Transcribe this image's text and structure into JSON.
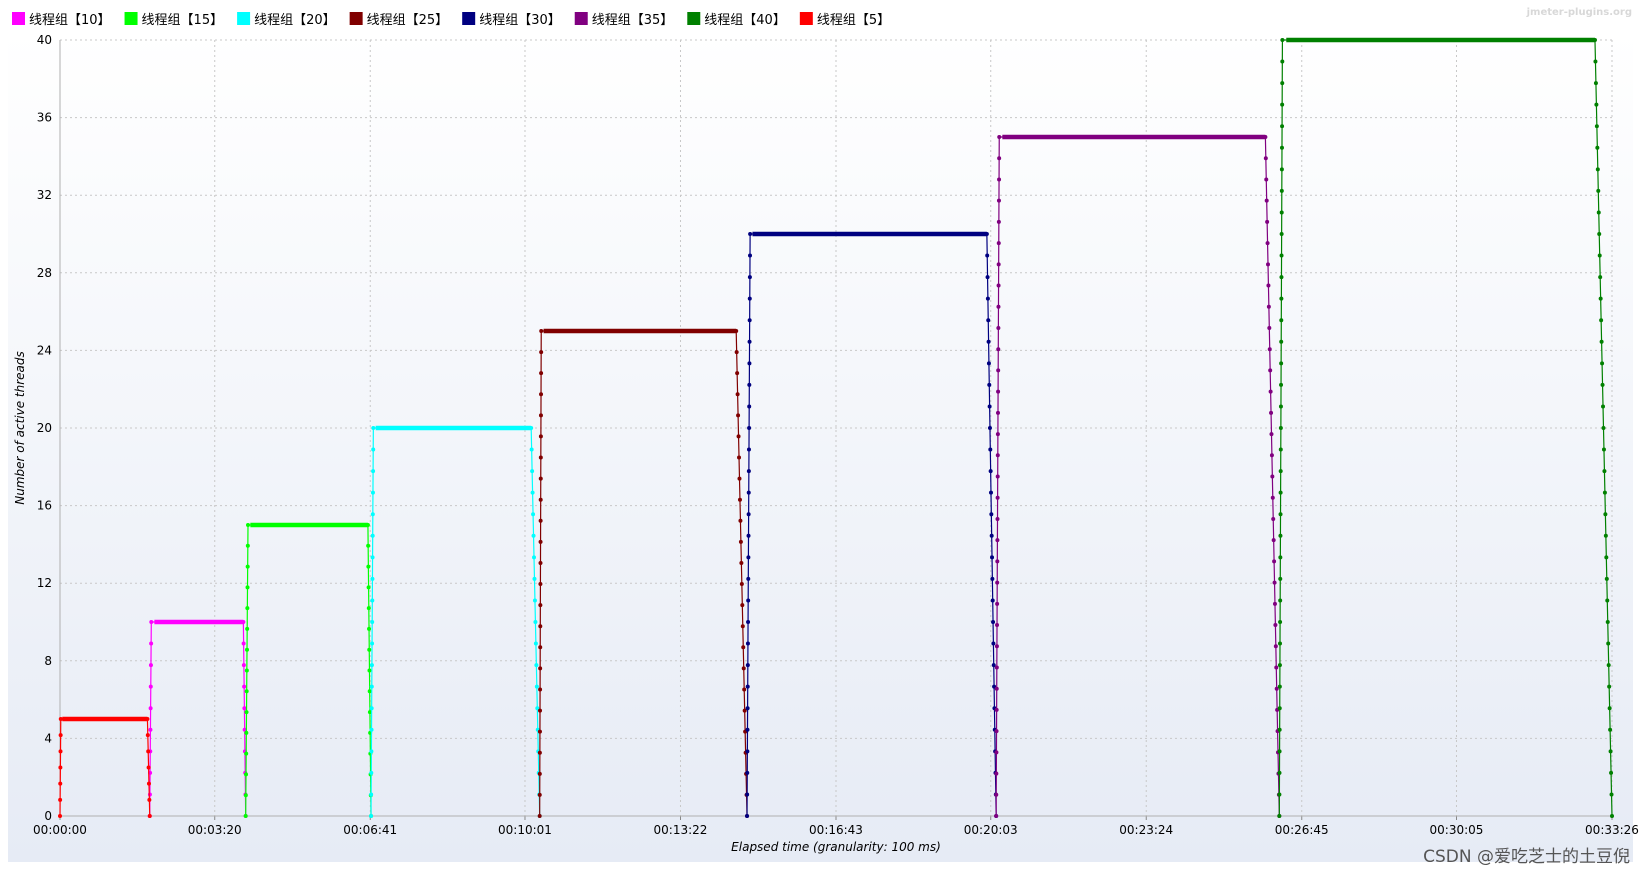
{
  "brand": "jmeter-plugins.org",
  "watermark": "CSDN @爱吃芝士的土豆倪",
  "chart_data": {
    "type": "line",
    "xlabel": "Elapsed time (granularity: 100 ms)",
    "ylabel": "Number of active threads",
    "xlim": [
      0,
      2006
    ],
    "ylim": [
      0,
      40
    ],
    "x_unit": "seconds elapsed (hh:mm:ss)",
    "x_ticks": [
      {
        "value": 0,
        "label": "00:00:00"
      },
      {
        "value": 200,
        "label": "00:03:20"
      },
      {
        "value": 401,
        "label": "00:06:41"
      },
      {
        "value": 601,
        "label": "00:10:01"
      },
      {
        "value": 802,
        "label": "00:13:22"
      },
      {
        "value": 1003,
        "label": "00:16:43"
      },
      {
        "value": 1203,
        "label": "00:20:03"
      },
      {
        "value": 1404,
        "label": "00:23:24"
      },
      {
        "value": 1605,
        "label": "00:26:45"
      },
      {
        "value": 1805,
        "label": "00:30:05"
      },
      {
        "value": 2006,
        "label": "00:33:26"
      }
    ],
    "y_ticks": [
      0,
      4,
      8,
      12,
      16,
      20,
      24,
      28,
      32,
      36,
      40
    ],
    "grid": true,
    "legend_position": "top-left",
    "series": [
      {
        "name": "线程组【10】",
        "color": "#ff00ff",
        "x": [
          116,
          118,
          122,
          237,
          240
        ],
        "y": [
          0,
          10,
          10,
          10,
          0
        ]
      },
      {
        "name": "线程组【15】",
        "color": "#00ff00",
        "x": [
          240,
          243,
          246,
          398,
          402
        ],
        "y": [
          0,
          15,
          15,
          15,
          0
        ]
      },
      {
        "name": "线程组【20】",
        "color": "#00ffff",
        "x": [
          402,
          405,
          408,
          609,
          620
        ],
        "y": [
          0,
          20,
          20,
          20,
          0
        ]
      },
      {
        "name": "线程组【25】",
        "color": "#800000",
        "x": [
          620,
          622,
          625,
          874,
          888
        ],
        "y": [
          0,
          25,
          25,
          25,
          0
        ]
      },
      {
        "name": "线程组【30】",
        "color": "#000080",
        "x": [
          888,
          892,
          895,
          1198,
          1210
        ],
        "y": [
          0,
          30,
          30,
          30,
          0
        ]
      },
      {
        "name": "线程组【35】",
        "color": "#800080",
        "x": [
          1210,
          1214,
          1218,
          1558,
          1576
        ],
        "y": [
          0,
          35,
          35,
          35,
          0
        ]
      },
      {
        "name": "线程组【40】",
        "color": "#008000",
        "x": [
          1576,
          1580,
          1585,
          1984,
          2006
        ],
        "y": [
          0,
          40,
          40,
          40,
          0
        ]
      },
      {
        "name": "线程组【5】",
        "color": "#ff0000",
        "x": [
          0,
          1,
          3,
          113,
          116
        ],
        "y": [
          0,
          5,
          5,
          5,
          0
        ]
      }
    ]
  }
}
